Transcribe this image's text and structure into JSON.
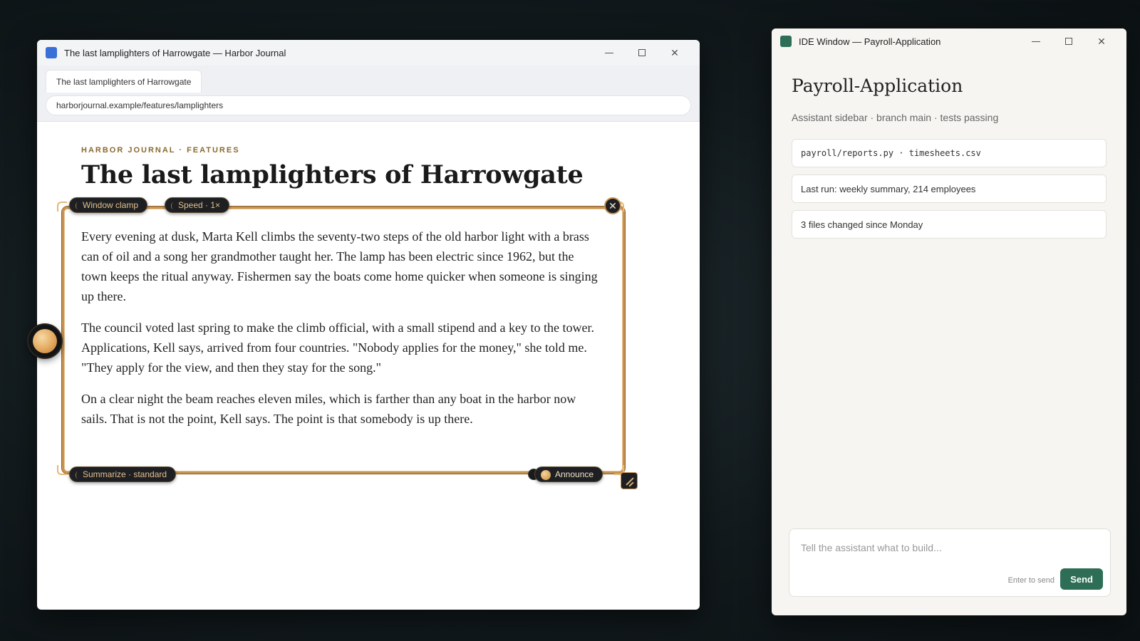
{
  "browser": {
    "window_title": "The last lamplighters of Harrowgate — Harbor Journal",
    "icon_color": "#3a6fd8",
    "tab_label": "The last lamplighters of Harrowgate",
    "url": "harborjournal.example/features/lamplighters",
    "article": {
      "kicker": "HARBOR JOURNAL · FEATURES",
      "headline": "The last lamplighters of Harrowgate",
      "paragraphs": [
        "Every evening at dusk, Marta Kell climbs the seventy-two steps of the old harbor light with a brass can of oil and a song her grandmother taught her. The lamp has been electric since 1962, but the town keeps the ritual anyway. Fishermen say the boats come home quicker when someone is singing up there.",
        "The council voted last spring to make the climb official, with a small stipend and a key to the tower. Applications, Kell says, arrived from four countries. \"Nobody applies for the money,\" she told me. \"They apply for the view, and then they stay for the song.\"",
        "On a clear night the beam reaches eleven miles, which is farther than any boat in the harbor now sails. That is not the point, Kell says. The point is that somebody is up there."
      ]
    }
  },
  "overlay": {
    "window_clamp_label": "Window clamp",
    "speed_label": "Speed · 1×",
    "summarize_label": "Summarize · standard",
    "announce_label": "Announce",
    "close_glyph": "✕",
    "accent_color": "#c59352"
  },
  "ide": {
    "window_title": "IDE Window — Payroll-Application",
    "icon_color": "#2f6e56",
    "project_title": "Payroll-Application",
    "subtitle": "Assistant sidebar · branch main · tests passing",
    "cards": [
      "payroll/reports.py · timesheets.csv",
      "Last run: weekly summary, 214 employees",
      "3 files changed since Monday"
    ],
    "composer": {
      "placeholder": "Tell the assistant what to build...",
      "hint": "Enter to send",
      "send_label": "Send"
    }
  },
  "window_controls": {
    "minimize": "—",
    "close": "✕"
  }
}
